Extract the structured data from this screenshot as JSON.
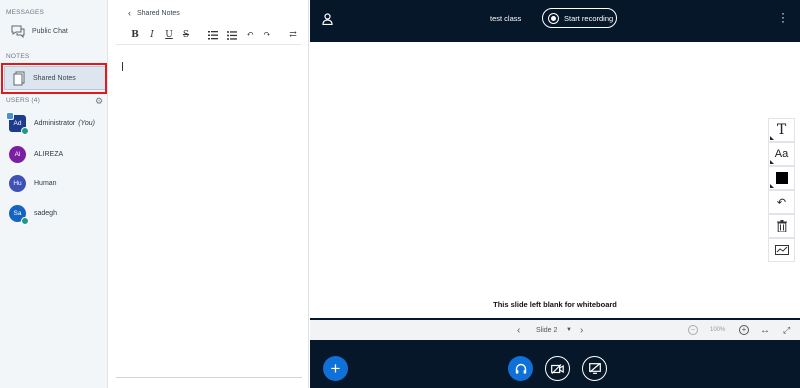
{
  "sidebar": {
    "messages_title": "MESSAGES",
    "public_chat": "Public Chat",
    "notes_title": "NOTES",
    "shared_notes": "Shared Notes",
    "users_title": "USERS (4)",
    "users": [
      {
        "initials": "Ad",
        "name": "Administrator",
        "role": "(You)",
        "color": "#1d3c8c"
      },
      {
        "initials": "Al",
        "name": "ALIREZA",
        "role": "",
        "color": "#7b1fa2"
      },
      {
        "initials": "Hu",
        "name": "Human",
        "role": "",
        "color": "#3f51b5"
      },
      {
        "initials": "Sa",
        "name": "sadegh",
        "role": "",
        "color": "#1565c0"
      }
    ]
  },
  "notes": {
    "title": "Shared Notes",
    "toolbar": [
      "B",
      "I",
      "U",
      "S"
    ]
  },
  "presentation": {
    "meeting_title": "test class",
    "record_label": "Start recording",
    "slide_caption": "This slide left blank for whiteboard",
    "slide_label": "Slide 2",
    "zoom": "100%",
    "colors": {
      "accent": "#0f70d7",
      "dark": "#06172a"
    }
  }
}
